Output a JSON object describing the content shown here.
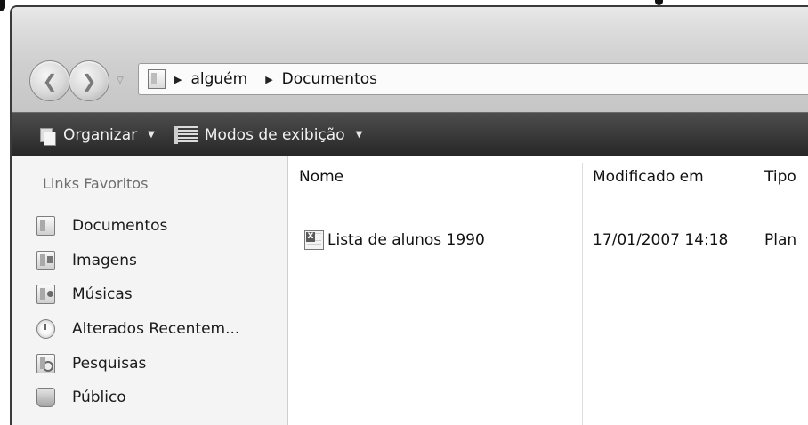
{
  "address_bar": {
    "crumbs": [
      "alguém",
      "Documentos"
    ]
  },
  "command_bar": {
    "organize_label": "Organizar",
    "views_label": "Modos de exibição"
  },
  "nav_pane": {
    "title": "Links Favoritos",
    "items": [
      {
        "label": "Documentos",
        "icon": "documents-folder-icon"
      },
      {
        "label": "Imagens",
        "icon": "pictures-folder-icon"
      },
      {
        "label": "Músicas",
        "icon": "music-folder-icon"
      },
      {
        "label": "Alterados Recentem...",
        "icon": "recent-changes-icon"
      },
      {
        "label": "Pesquisas",
        "icon": "searches-folder-icon"
      },
      {
        "label": "Público",
        "icon": "public-folder-icon"
      }
    ]
  },
  "file_list": {
    "columns": [
      "Nome",
      "Modificado em",
      "Tipo"
    ],
    "rows": [
      {
        "name": "Lista de alunos 1990",
        "modified": "17/01/2007 14:18",
        "type": "Plan",
        "icon": "spreadsheet-file-icon"
      }
    ]
  }
}
